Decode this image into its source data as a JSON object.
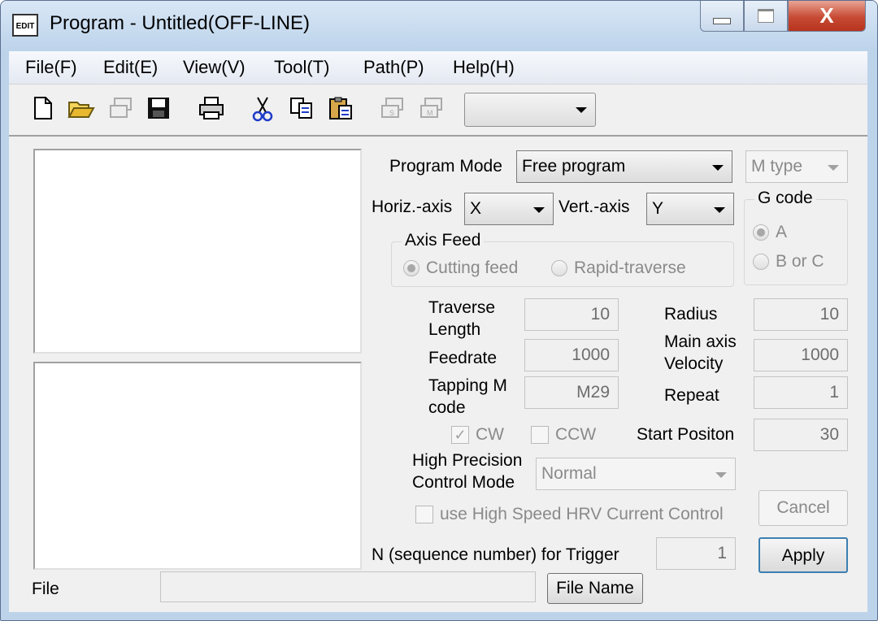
{
  "window": {
    "icon_text": "EDIT",
    "title": "Program - Untitled(OFF-LINE)",
    "close_glyph": "X"
  },
  "menu": [
    "File(F)",
    "Edit(E)",
    "View(V)",
    "Tool(T)",
    "Path(P)",
    "Help(H)"
  ],
  "toolbar": {
    "icons": [
      "new-file-icon",
      "open-folder-icon",
      "transfer-icon",
      "save-icon",
      "print-icon",
      "cut-icon",
      "copy-icon",
      "paste-icon",
      "send-s-icon",
      "send-m-icon"
    ],
    "combo_value": ""
  },
  "form": {
    "program_mode_label": "Program Mode",
    "program_mode_value": "Free program",
    "m_type_value": "M type",
    "horiz_axis_label": "Horiz.-axis",
    "horiz_axis_value": "X",
    "vert_axis_label": "Vert.-axis",
    "vert_axis_value": "Y",
    "g_code_title": "G code",
    "g_code_options": [
      "A",
      "B or C"
    ],
    "g_code_selected": "A",
    "axis_feed_title": "Axis Feed",
    "axis_feed_options": [
      "Cutting feed",
      "Rapid-traverse"
    ],
    "axis_feed_selected": "Cutting feed",
    "traverse_length_label": "Traverse Length",
    "traverse_length_value": "10",
    "radius_label": "Radius",
    "radius_value": "10",
    "feedrate_label": "Feedrate",
    "feedrate_value": "1000",
    "main_axis_velocity_label": "Main axis Velocity",
    "main_axis_velocity_value": "1000",
    "tapping_m_code_label": "Tapping M code",
    "tapping_m_code_value": "M29",
    "repeat_label": "Repeat",
    "repeat_value": "1",
    "cw_label": "CW",
    "cw_checked": true,
    "ccw_label": "CCW",
    "ccw_checked": false,
    "start_position_label": "Start Positon",
    "start_position_value": "30",
    "hpc_mode_label": "High Precision Control Mode",
    "hpc_mode_value": "Normal",
    "hrv_label": "use High Speed HRV Current Control",
    "hrv_checked": false,
    "cancel_label": "Cancel",
    "trigger_label": "N (sequence number) for Trigger",
    "trigger_value": "1",
    "apply_label": "Apply"
  },
  "file_bar": {
    "label": "File",
    "value": "",
    "button_label": "File Name"
  }
}
